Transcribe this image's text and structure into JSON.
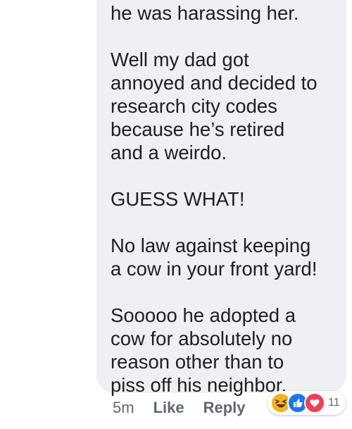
{
  "comment": {
    "paragraphs": [
      "he was harassing her.",
      "Well my dad got\nannoyed and decided to\nresearch city codes\nbecause he’s retired\nand a weirdo.",
      "GUESS WHAT!",
      "No law against keeping\na cow in your front yard!",
      "Sooooo he adopted a\ncow for absolutely no\nreason other than to\npiss off his neighbor."
    ]
  },
  "actions": {
    "time": "5m",
    "like_label": "Like",
    "reply_label": "Reply"
  },
  "reactions": {
    "icons": [
      "haha-icon",
      "like-icon",
      "love-icon"
    ],
    "count": "11",
    "colors": {
      "haha": "#f7b125",
      "like": "#1877f2",
      "love": "#f33e58"
    }
  },
  "colors": {
    "bubble": "#eff0f3",
    "text": "#1c1e21",
    "meta": "#606770"
  }
}
